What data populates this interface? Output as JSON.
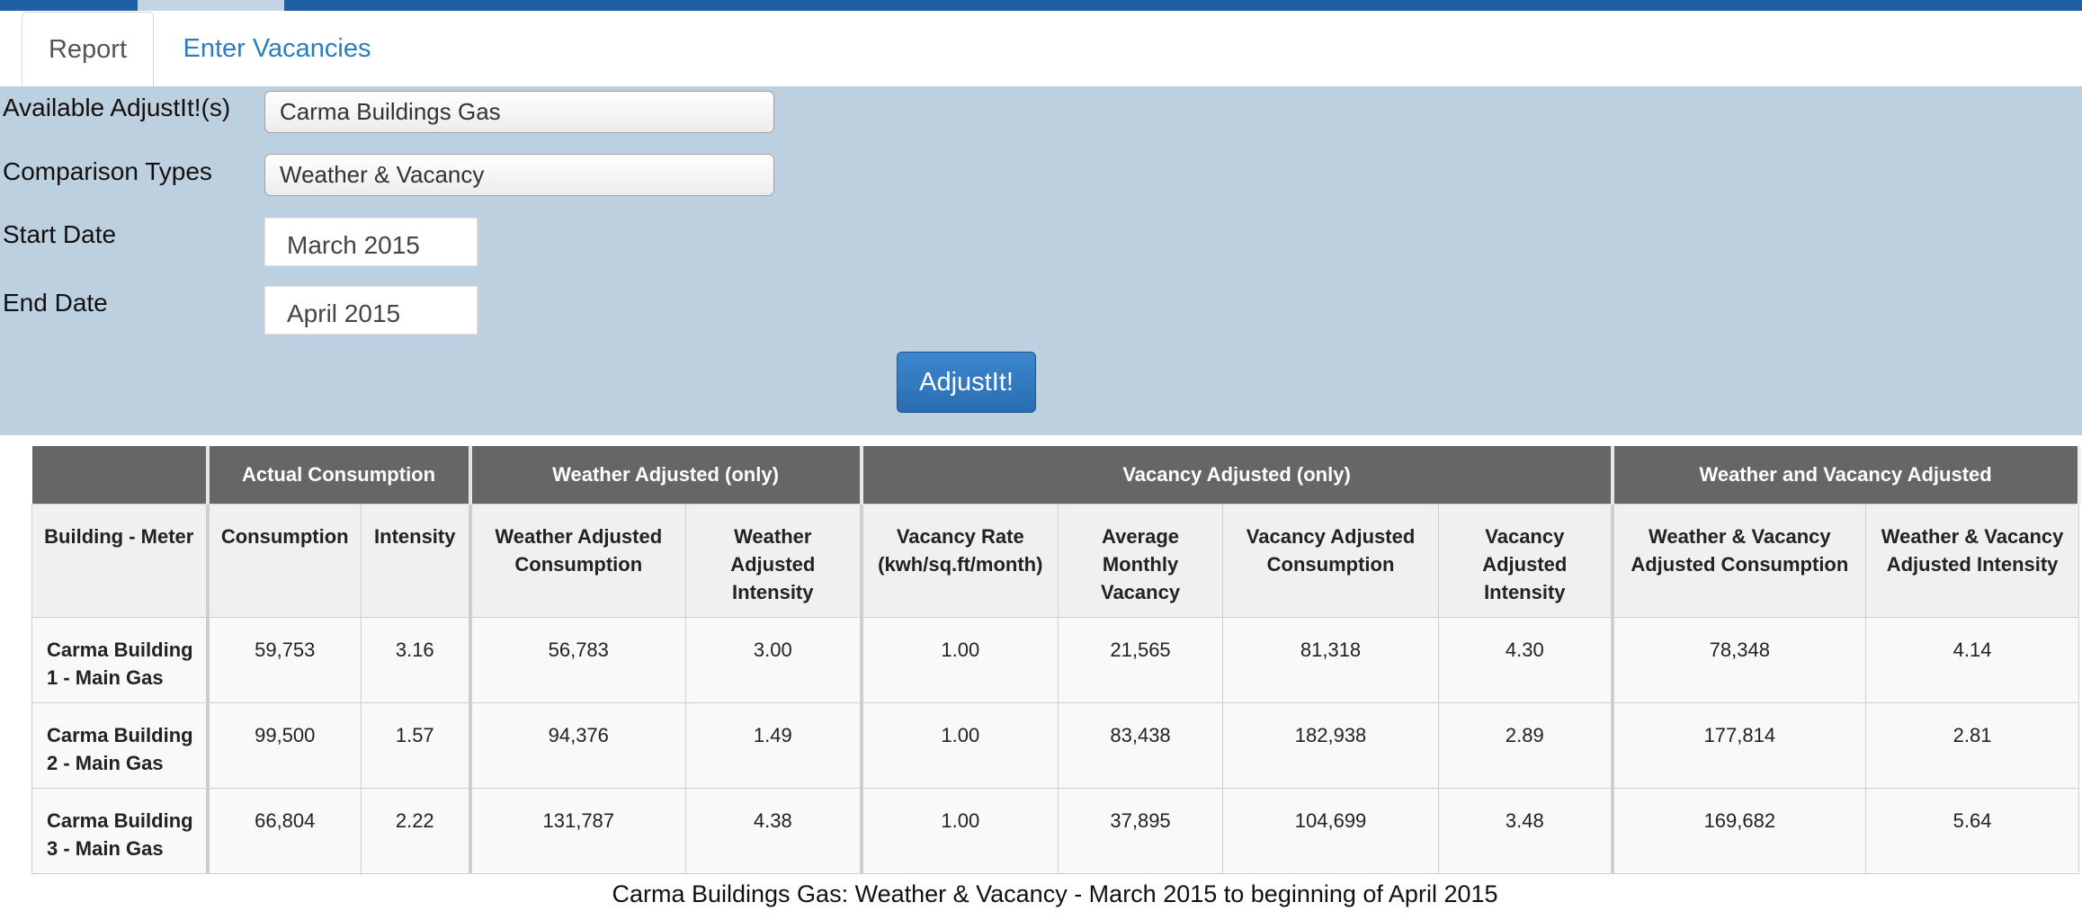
{
  "colors": {
    "topbar": "#1f5fa3",
    "panel": "#bdd0e0",
    "link": "#2a7dc3",
    "button": "#2a6db2",
    "group_header": "#666666"
  },
  "tabs": [
    {
      "label": "Report",
      "active": true
    },
    {
      "label": "Enter Vacancies",
      "active": false
    }
  ],
  "form": {
    "available_label": "Available AdjustIt!(s)",
    "available_value": "Carma Buildings Gas",
    "comparison_label": "Comparison Types",
    "comparison_value": "Weather & Vacancy",
    "start_label": "Start Date",
    "start_value": "March 2015",
    "end_label": "End Date",
    "end_value": "April 2015",
    "submit_label": "AdjustIt!"
  },
  "table": {
    "groups": [
      "",
      "Actual Consumption",
      "Weather Adjusted (only)",
      "Vacancy Adjusted (only)",
      "Weather and Vacancy Adjusted"
    ],
    "columns": [
      "Building - Meter",
      "Consumption",
      "Intensity",
      "Weather Adjusted Consumption",
      "Weather Adjusted Intensity",
      "Vacancy Rate (kwh/sq.ft/month)",
      "Average Monthly Vacancy",
      "Vacancy Adjusted Consumption",
      "Vacancy Adjusted Intensity",
      "Weather & Vacancy Adjusted Consumption",
      "Weather & Vacancy Adjusted Intensity"
    ],
    "rows": [
      [
        "Carma Building 1 - Main Gas",
        "59,753",
        "3.16",
        "56,783",
        "3.00",
        "1.00",
        "21,565",
        "81,318",
        "4.30",
        "78,348",
        "4.14"
      ],
      [
        "Carma Building 2 - Main Gas",
        "99,500",
        "1.57",
        "94,376",
        "1.49",
        "1.00",
        "83,438",
        "182,938",
        "2.89",
        "177,814",
        "2.81"
      ],
      [
        "Carma Building 3 - Main Gas",
        "66,804",
        "2.22",
        "131,787",
        "4.38",
        "1.00",
        "37,895",
        "104,699",
        "3.48",
        "169,682",
        "5.64"
      ]
    ]
  },
  "caption": "Carma Buildings Gas: Weather & Vacancy - March 2015 to beginning of April 2015"
}
